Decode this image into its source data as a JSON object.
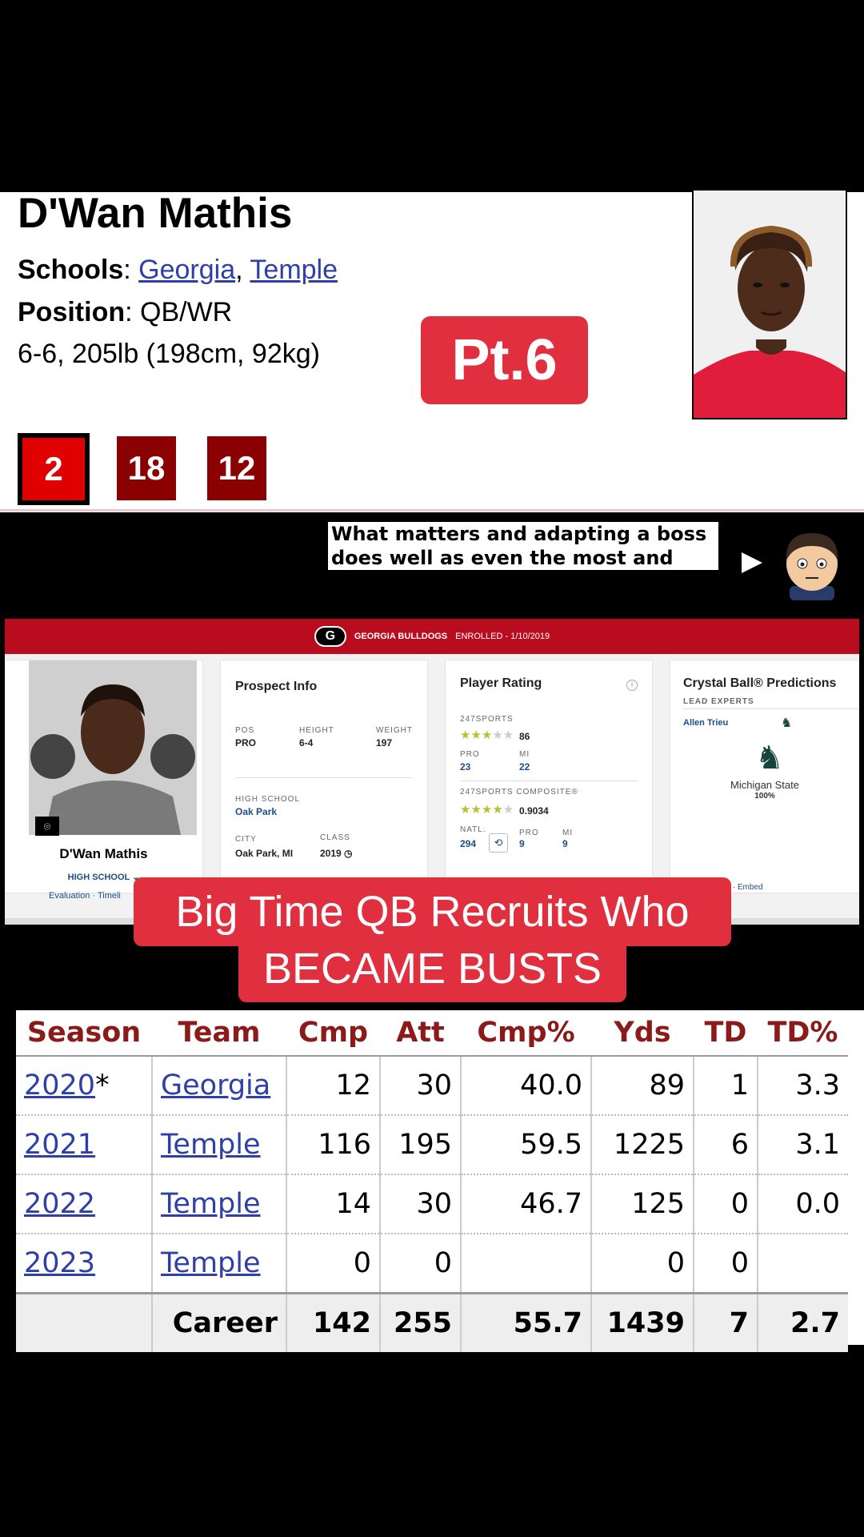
{
  "sr": {
    "name": "D'Wan Mathis",
    "schools_label": "Schools",
    "sep": ": ",
    "school1": "Georgia",
    "comma": ", ",
    "school2": "Temple",
    "position_label": "Position",
    "position": "QB/WR",
    "size": "6-6, 205lb (198cm, 92kg)",
    "jerseys": [
      "2",
      "18",
      "12"
    ]
  },
  "badge": "Pt.6",
  "ad": {
    "line1": "What matters and adapting a boss",
    "line2": "does well as even the most and"
  },
  "web247": {
    "banner_team": "GEORGIA BULLDOGS",
    "banner_enrolled": "ENROLLED - 1/10/2019",
    "badge_icon": "</>",
    "player_name": "D'Wan Mathis",
    "high_school_tab": "HIGH SCHOOL ⌄",
    "links": "Evaluation · Timeli",
    "prospect": {
      "title": "Prospect Info",
      "pos_label": "POS",
      "pos": "PRO",
      "height_label": "HEIGHT",
      "height": "6-4",
      "weight_label": "WEIGHT",
      "weight": "197",
      "hs_label": "HIGH SCHOOL",
      "hs": "Oak Park",
      "city_label": "CITY",
      "city": "Oak Park, MI",
      "class_label": "CLASS",
      "class": "2019"
    },
    "rating": {
      "title": "Player Rating",
      "s247_label": "247SPORTS",
      "s247_score": "86",
      "pro_label": "PRO",
      "pro": "23",
      "mi_label": "MI",
      "mi": "22",
      "comp_label": "247SPORTS COMPOSITE®",
      "comp_score": "0.9034",
      "natl_label": "NATL.",
      "natl": "294",
      "pro2_label": "PRO",
      "pro2": "9",
      "mi2_label": "MI",
      "mi2": "9"
    },
    "crystal": {
      "title": "Crystal Ball® Predictions",
      "lead": "LEAD EXPERTS",
      "expert": "Allen Trieu",
      "team": "Michigan State",
      "pct": "100%",
      "embed": "s · Embed"
    }
  },
  "overlay": {
    "line1": "Big Time QB Recruits Who",
    "line2": "BECAME BUSTS"
  },
  "stats": {
    "headers": [
      "Season",
      "Team",
      "Cmp",
      "Att",
      "Cmp%",
      "Yds",
      "TD",
      "TD%"
    ],
    "rows": [
      {
        "season": "2020",
        "mark": "*",
        "team": "Georgia",
        "cmp": "12",
        "att": "30",
        "pct": "40.0",
        "yds": "89",
        "td": "1",
        "tdp": "3.3"
      },
      {
        "season": "2021",
        "mark": "",
        "team": "Temple",
        "cmp": "116",
        "att": "195",
        "pct": "59.5",
        "yds": "1225",
        "td": "6",
        "tdp": "3.1"
      },
      {
        "season": "2022",
        "mark": "",
        "team": "Temple",
        "cmp": "14",
        "att": "30",
        "pct": "46.7",
        "yds": "125",
        "td": "0",
        "tdp": "0.0"
      },
      {
        "season": "2023",
        "mark": "",
        "team": "Temple",
        "cmp": "0",
        "att": "0",
        "pct": "",
        "yds": "0",
        "td": "0",
        "tdp": ""
      }
    ],
    "career": {
      "label": "Career",
      "cmp": "142",
      "att": "255",
      "pct": "55.7",
      "yds": "1439",
      "td": "7",
      "tdp": "2.7"
    }
  },
  "colors": {
    "accent_red": "#e03040",
    "jersey_dark": "#8b0000",
    "jersey_bright": "#e00000",
    "link": "#2f3fa8",
    "header_text": "#8b1a1a",
    "uga_red": "#ba0c1f"
  }
}
